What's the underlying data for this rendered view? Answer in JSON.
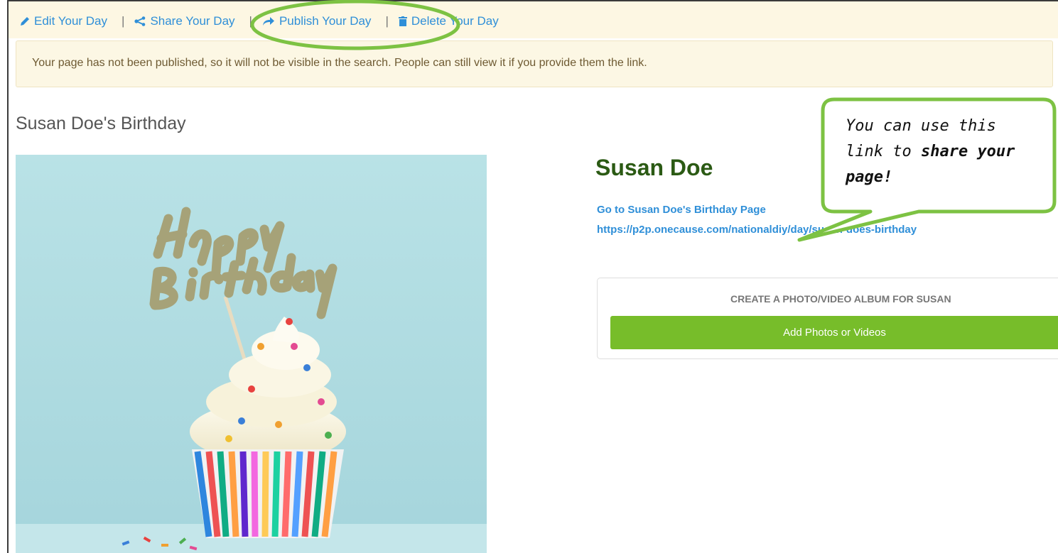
{
  "toolbar": {
    "edit_label": "Edit Your Day",
    "share_label": "Share Your Day",
    "publish_label": "Publish Your Day",
    "delete_label": "Delete Your Day",
    "separator": "|"
  },
  "notice": {
    "text": "Your page has not been published, so it will not be visible in the search. People can still view it if you provide them the link."
  },
  "page_title": "Susan Doe's Birthday",
  "profile": {
    "name": "Susan Doe",
    "page_link": "Go to Susan Doe's Birthday Page",
    "url": "https://p2p.onecause.com/nationaldiy/day/susan-does-birthday"
  },
  "album": {
    "heading": "CREATE A PHOTO/VIDEO ALBUM FOR SUSAN",
    "button_label": "Add Photos or Videos"
  },
  "callout": {
    "part1": "You can use this link to ",
    "part2": "share your page!"
  },
  "colors": {
    "link": "#2f8fd8",
    "annotation_green": "#7dc243",
    "name_green": "#2b5a14",
    "button_green": "#77bd2a",
    "notice_bg": "#fcf7e4"
  },
  "icons": [
    "pencil-icon",
    "share-icon",
    "publish-arrow-icon",
    "trash-icon"
  ]
}
